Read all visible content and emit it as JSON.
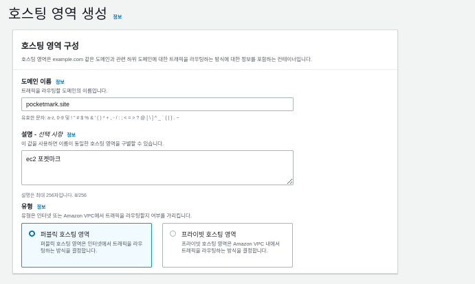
{
  "page": {
    "title": "호스팅 영역 생성",
    "info_label": "정보"
  },
  "panel": {
    "title": "호스팅 영역 구성",
    "description": "호스팅 영역은 example.com 같은 도메인과 관련 하위 도메인에 대한 트래픽을 라우팅하는 방식에 대한 정보를 포함하는 컨테이너입니다."
  },
  "domain_field": {
    "label": "도메인 이름",
    "info_label": "정보",
    "hint": "트래픽을 라우팅할 도메인의 이름입니다.",
    "value": "pocketmark.site",
    "constraint": "유효한 문자: a-z, 0-9 및 ! \" # $ % & ' ( ) * + , - / : ; < = > ? @ [ \\ ] ^ _ ` { | } . ~"
  },
  "description_field": {
    "label_main": "설명 - ",
    "label_optional": "선택 사항",
    "info_label": "정보",
    "hint": "이 값을 사용하면 이름이 동일한 호스팅 영역을 구별할 수 있습니다.",
    "value": "ec2 포켓마크",
    "constraint": "설명은 최대 256자입니다. 8/256"
  },
  "type_field": {
    "label": "유형",
    "info_label": "정보",
    "hint": "유형은 인터넷 또는 Amazon VPC에서 트래픽을 라우팅할지 여부를 가리킵니다.",
    "options": [
      {
        "title": "퍼블릭 호스팅 영역",
        "description": "퍼블릭 호스팅 영역은 인터넷에서 트래픽을 라우팅하는 방식을 결정합니다.",
        "selected": true
      },
      {
        "title": "프라이빗 호스팅 영역",
        "description": "프라이빗 호스팅 영역은 Amazon VPC 내에서 트래픽을 라우팅하는 방식을 결정합니다.",
        "selected": false
      }
    ]
  },
  "colors": {
    "accent": "#0073bb",
    "selected_border": "#00a1c9",
    "selected_bg": "#f1faff"
  }
}
